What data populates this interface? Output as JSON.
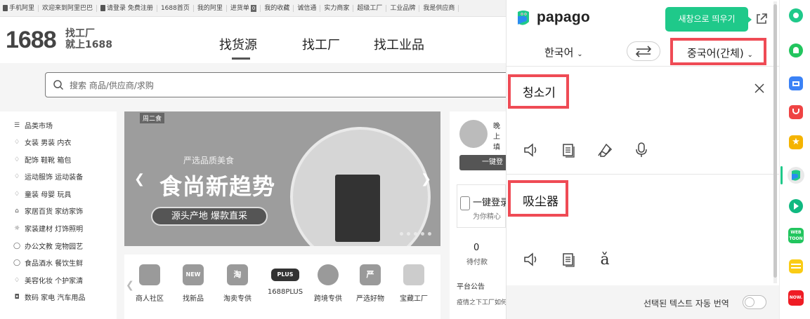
{
  "site": {
    "topbar": [
      "手机阿里",
      "欢迎来到阿里巴巴",
      "请登录",
      "免费注册",
      "1688首页",
      "我的阿里",
      "进货单",
      "0",
      "我的收藏",
      "诚信通",
      "实力商家",
      "超级工厂",
      "工业品牌",
      "我是供应商"
    ],
    "logo": "1688",
    "logo_sub": "找工厂\n就上1688",
    "nav_tabs": [
      "找货源",
      "找工厂",
      "找工业品"
    ],
    "search_placeholder": "搜索 商品/供应商/求购",
    "categories_title": "品类市场",
    "categories": [
      {
        "icon": "shirt-icon",
        "text": "女装  男装  内衣"
      },
      {
        "icon": "heel-icon",
        "text": "配饰  鞋靴  箱包"
      },
      {
        "icon": "sport-icon",
        "text": "运动服饰  运动装备"
      },
      {
        "icon": "kids-icon",
        "text": "童装  母婴  玩具"
      },
      {
        "icon": "home-icon",
        "text": "家居百货  家纺家饰"
      },
      {
        "icon": "bulb-icon",
        "text": "家装建材  灯饰照明"
      },
      {
        "icon": "chat-icon",
        "text": "办公文教  宠物园艺"
      },
      {
        "icon": "apple-icon",
        "text": "食品酒水  餐饮生鲜"
      },
      {
        "icon": "bottle-icon",
        "text": "美容化妆  个护家清"
      },
      {
        "icon": "camera-icon",
        "text": "数码  家电  汽车用品"
      }
    ],
    "banner": {
      "tag": "周二食",
      "small": "严选品质美食",
      "big": "食尚新趋势",
      "pill": "源头产地 爆款直采"
    },
    "services": [
      {
        "icon": "community-icon",
        "glyph": "",
        "label": "商人社区"
      },
      {
        "icon": "new-icon",
        "glyph": "NEW",
        "label": "找新品"
      },
      {
        "icon": "tao-icon",
        "glyph": "淘",
        "label": "淘卖专供"
      },
      {
        "icon": "plus-icon",
        "glyph": "PLUS",
        "label": "1688PLUS"
      },
      {
        "icon": "plane-icon",
        "glyph": "",
        "label": "跨境专供"
      },
      {
        "icon": "yan-icon",
        "glyph": "严",
        "label": "严选好物"
      },
      {
        "icon": "factory-icon",
        "glyph": "",
        "label": "宝藏工厂"
      }
    ],
    "user": {
      "greet": "晚上",
      "greet2": "填",
      "login_btn": "一键登",
      "quick_title": "一键登录",
      "quick_sub": "为你精心",
      "pending_num": "0",
      "pending_label": "待付款",
      "notice": "平台公告",
      "notice_sub": "疫情之下工厂如何"
    }
  },
  "papago": {
    "logo_text": "papago",
    "new_window": "새창으로 띄우기",
    "src_lang": "한국어",
    "tgt_lang": "중국어(간체)",
    "src_text": "청소기",
    "tgt_text": "吸尘器",
    "pinyin_glyph": "ǎ",
    "auto_translate_label": "선택된 텍스트 자동 번역",
    "auto_translate_on": false,
    "colors": {
      "brand": "#1fc98a",
      "highlight": "#ef4b55"
    }
  },
  "extensions": [
    {
      "name": "green-circle-ext-icon",
      "color": "#1fc98a"
    },
    {
      "name": "green-bell-ext-icon",
      "color": "#22c55e"
    },
    {
      "name": "blue-bag-ext-icon",
      "color": "#3b82f6"
    },
    {
      "name": "red-pocket-ext-icon",
      "color": "#ef4444"
    },
    {
      "name": "yellow-star-ext-icon",
      "color": "#f5b400"
    },
    {
      "name": "papago-ext-icon",
      "color": "#1fc98a"
    },
    {
      "name": "green-play-ext-icon",
      "color": "#10b981"
    },
    {
      "name": "webtoon-ext-icon",
      "color": "#22c55e"
    },
    {
      "name": "yellow-memo-ext-icon",
      "color": "#facc15"
    },
    {
      "name": "now-ext-icon",
      "color": "#ef1c24"
    }
  ]
}
